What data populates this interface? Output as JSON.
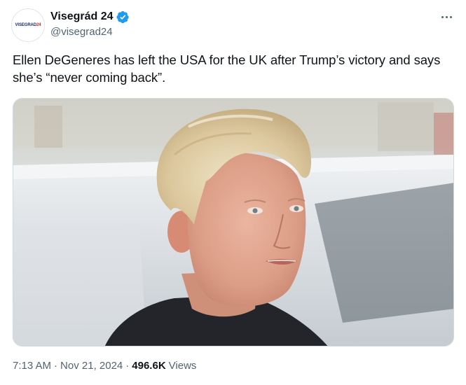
{
  "author": {
    "name": "Visegrád 24",
    "handle": "@visegrad24",
    "avatar_text_primary": "VISEGRAD",
    "avatar_text_accent": "24",
    "verified_color": "#1d9bf0"
  },
  "more_icon": "more-horizontal-icon",
  "tweet": {
    "text": "Ellen DeGeneres has left the USA for the UK after Trump’s victory and says she’s “never coming back”."
  },
  "footer": {
    "time": "7:13 AM",
    "separator": "·",
    "date": "Nov 21, 2024",
    "views_count": "496.6K",
    "views_label": "Views"
  }
}
